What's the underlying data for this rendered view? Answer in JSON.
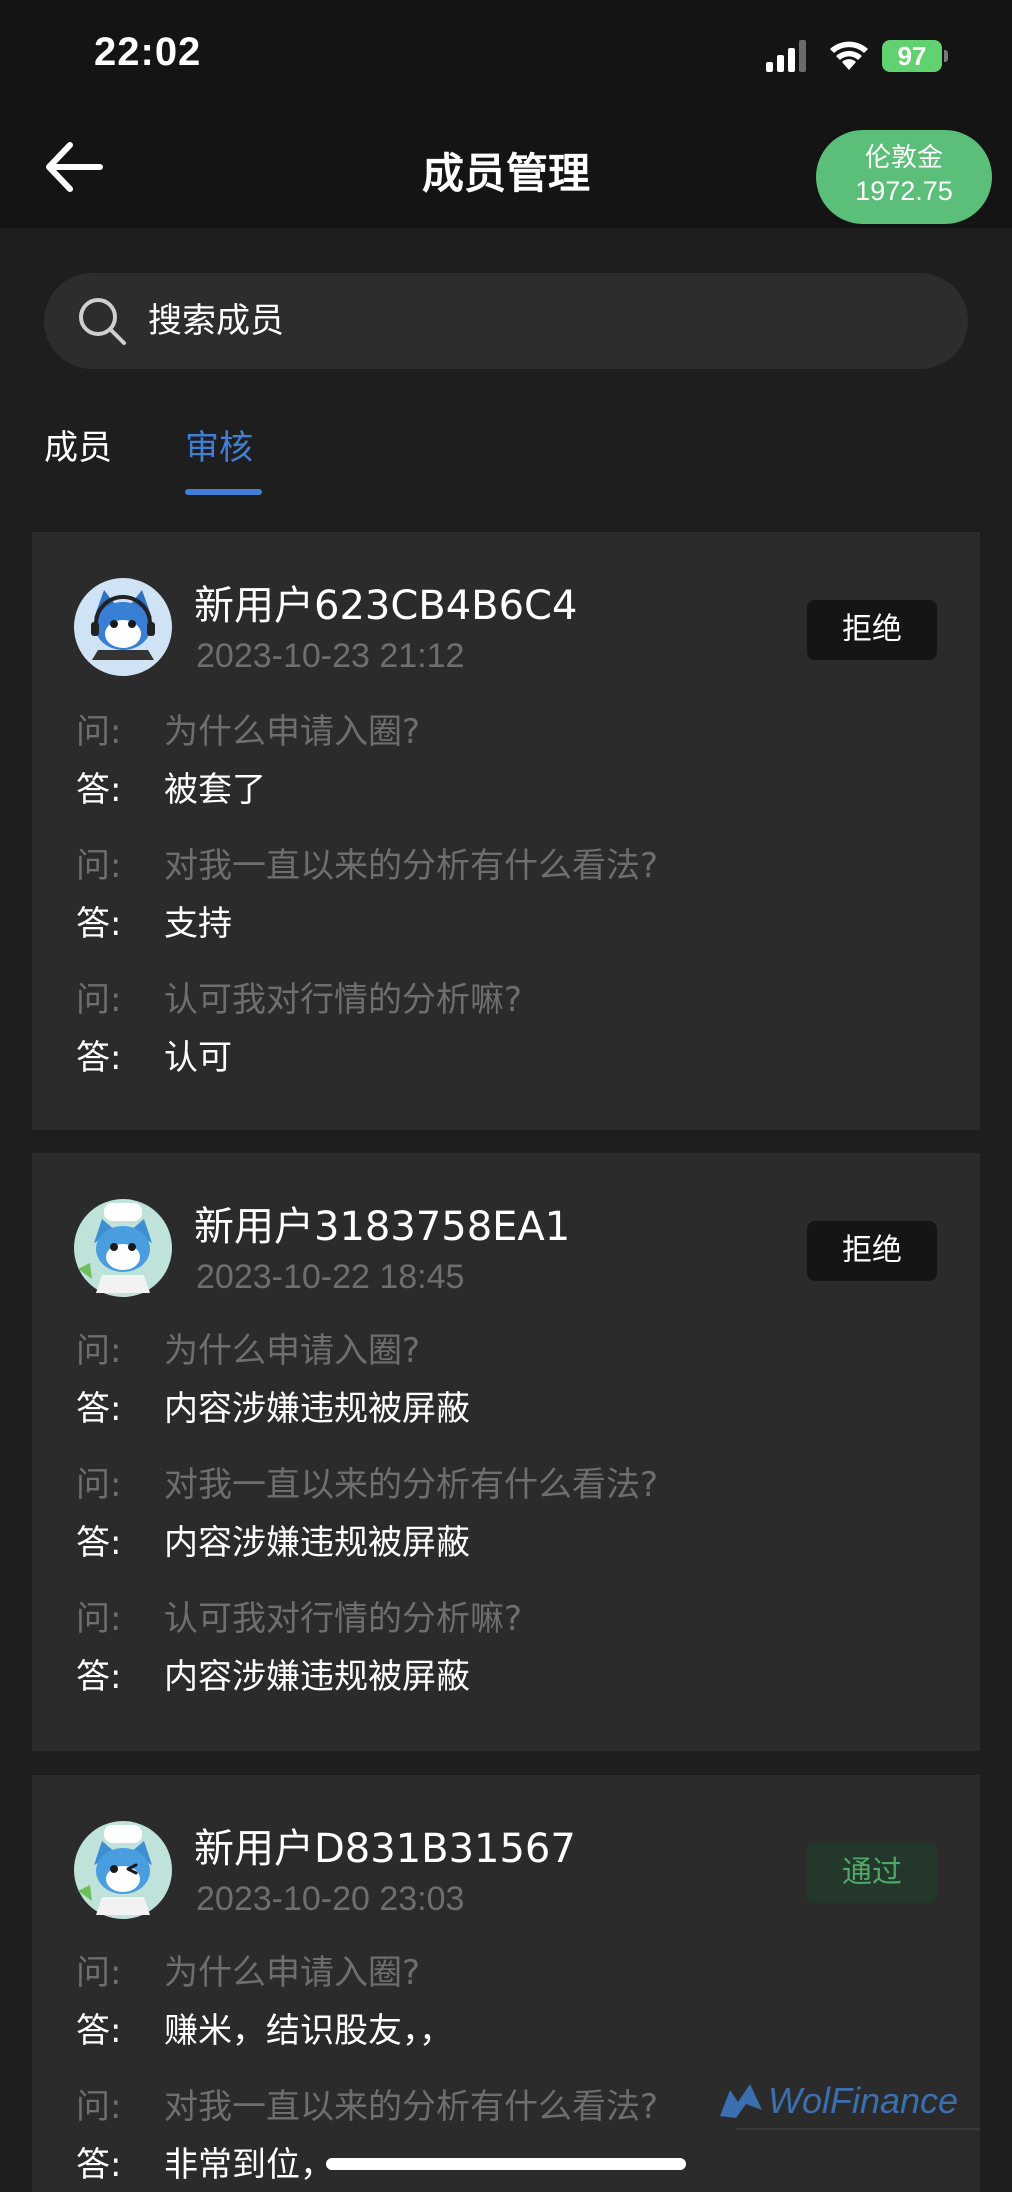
{
  "status_bar": {
    "time": "22:02",
    "battery": "97",
    "icons": [
      "signal-icon",
      "wifi-icon",
      "battery-icon"
    ]
  },
  "nav": {
    "title": "成员管理",
    "back_icon": "arrow-left-icon",
    "balance_label": "伦敦金",
    "balance_value": "1972.75"
  },
  "search": {
    "placeholder": "搜索成员",
    "icon": "search-icon"
  },
  "tabs": [
    {
      "label": "成员",
      "active": false
    },
    {
      "label": "审核",
      "active": true
    }
  ],
  "colors": {
    "accent": "#3f7fd4",
    "pill": "#5bbf79",
    "card": "#2b2b2b",
    "muted": "#6e6e6e",
    "pass": "#4fa866"
  },
  "q_prefix": "问:",
  "a_prefix": "答:",
  "applications": [
    {
      "name": "新用户623CB4B6C4",
      "time": "2023-10-23 21:12",
      "status": "拒绝",
      "qa": [
        {
          "q": "为什么申请入圈?",
          "a": "被套了"
        },
        {
          "q": "对我一直以来的分析有什么看法?",
          "a": "支持"
        },
        {
          "q": "认可我对行情的分析嘛?",
          "a": "认可"
        }
      ]
    },
    {
      "name": "新用户3183758EA1",
      "time": "2023-10-22 18:45",
      "status": "拒绝",
      "qa": [
        {
          "q": "为什么申请入圈?",
          "a": "内容涉嫌违规被屏蔽"
        },
        {
          "q": "对我一直以来的分析有什么看法?",
          "a": "内容涉嫌违规被屏蔽"
        },
        {
          "q": "认可我对行情的分析嘛?",
          "a": "内容涉嫌违规被屏蔽"
        }
      ]
    },
    {
      "name": "新用户D831B31567",
      "time": "2023-10-20 23:03",
      "status": "通过",
      "qa": [
        {
          "q": "为什么申请入圈?",
          "a": "赚米，结识股友，，"
        },
        {
          "q": "对我一直以来的分析有什么看法?",
          "a": "非常到位，"
        }
      ]
    }
  ],
  "watermark": "WolFinance"
}
